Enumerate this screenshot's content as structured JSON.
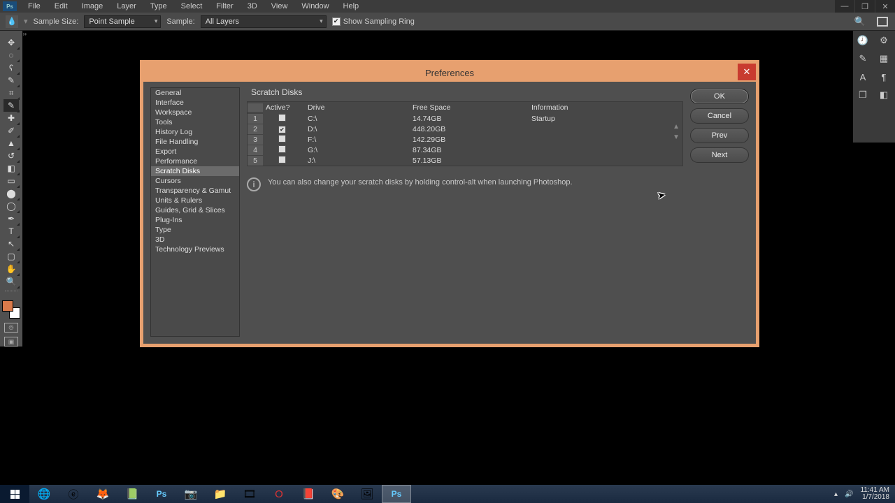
{
  "menubar": {
    "items": [
      "File",
      "Edit",
      "Image",
      "Layer",
      "Type",
      "Select",
      "Filter",
      "3D",
      "View",
      "Window",
      "Help"
    ]
  },
  "optionsbar": {
    "sampleSizeLabel": "Sample Size:",
    "sampleSizeValue": "Point Sample",
    "sampleLabel": "Sample:",
    "sampleValue": "All Layers",
    "showSamplingRing": "Show Sampling Ring"
  },
  "dialog": {
    "title": "Preferences",
    "section": "Scratch Disks",
    "categories": [
      "General",
      "Interface",
      "Workspace",
      "Tools",
      "History Log",
      "File Handling",
      "Export",
      "Performance",
      "Scratch Disks",
      "Cursors",
      "Transparency & Gamut",
      "Units & Rulers",
      "Guides, Grid & Slices",
      "Plug-Ins",
      "Type",
      "3D",
      "Technology Previews"
    ],
    "activeCategory": "Scratch Disks",
    "headers": {
      "active": "Active?",
      "drive": "Drive",
      "free": "Free Space",
      "info": "Information"
    },
    "rows": [
      {
        "idx": "1",
        "active": false,
        "drive": "C:\\",
        "free": "14.74GB",
        "info": "Startup"
      },
      {
        "idx": "2",
        "active": true,
        "drive": "D:\\",
        "free": "448.20GB",
        "info": ""
      },
      {
        "idx": "3",
        "active": false,
        "drive": "F:\\",
        "free": "142.29GB",
        "info": ""
      },
      {
        "idx": "4",
        "active": false,
        "drive": "G:\\",
        "free": "87.34GB",
        "info": ""
      },
      {
        "idx": "5",
        "active": false,
        "drive": "J:\\",
        "free": "57.13GB",
        "info": ""
      }
    ],
    "hint": "You can also change your scratch disks by holding control-alt when launching Photoshop.",
    "buttons": {
      "ok": "OK",
      "cancel": "Cancel",
      "prev": "Prev",
      "next": "Next"
    }
  },
  "taskbar": {
    "time": "11:41 AM",
    "date": "1/7/2018"
  },
  "colors": {
    "dialogBorder": "#e7a06f",
    "close": "#c83b2f"
  }
}
